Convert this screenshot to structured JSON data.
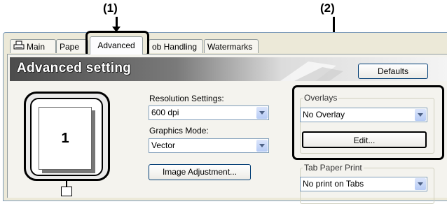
{
  "callouts": {
    "first": "(1)",
    "second": "(2)"
  },
  "tabs": [
    {
      "label": "Main",
      "active": false
    },
    {
      "label": "Pape",
      "active": false
    },
    {
      "label": "Advanced",
      "active": true
    },
    {
      "label": "ob Handling",
      "active": false
    },
    {
      "label": "Watermarks",
      "active": false
    }
  ],
  "header": {
    "title": "Advanced setting",
    "defaults_button": "Defaults"
  },
  "preview": {
    "page_number": "1"
  },
  "resolution": {
    "label": "Resolution Settings:",
    "value": "600 dpi"
  },
  "graphics": {
    "label": "Graphics Mode:",
    "value": "Vector"
  },
  "image_adjustment_button": "Image Adjustment...",
  "overlays": {
    "legend": "Overlays",
    "value": "No Overlay",
    "edit_button": "Edit..."
  },
  "tab_paper": {
    "legend": "Tab Paper Print",
    "value": "No print on Tabs"
  },
  "icons": {
    "main_tab": "printer-icon",
    "dropdown": "chevron-down-icon"
  },
  "colors": {
    "banner_dark": "#4c4c4c",
    "panel": "#f4f3ee",
    "highlight": "#000000"
  }
}
